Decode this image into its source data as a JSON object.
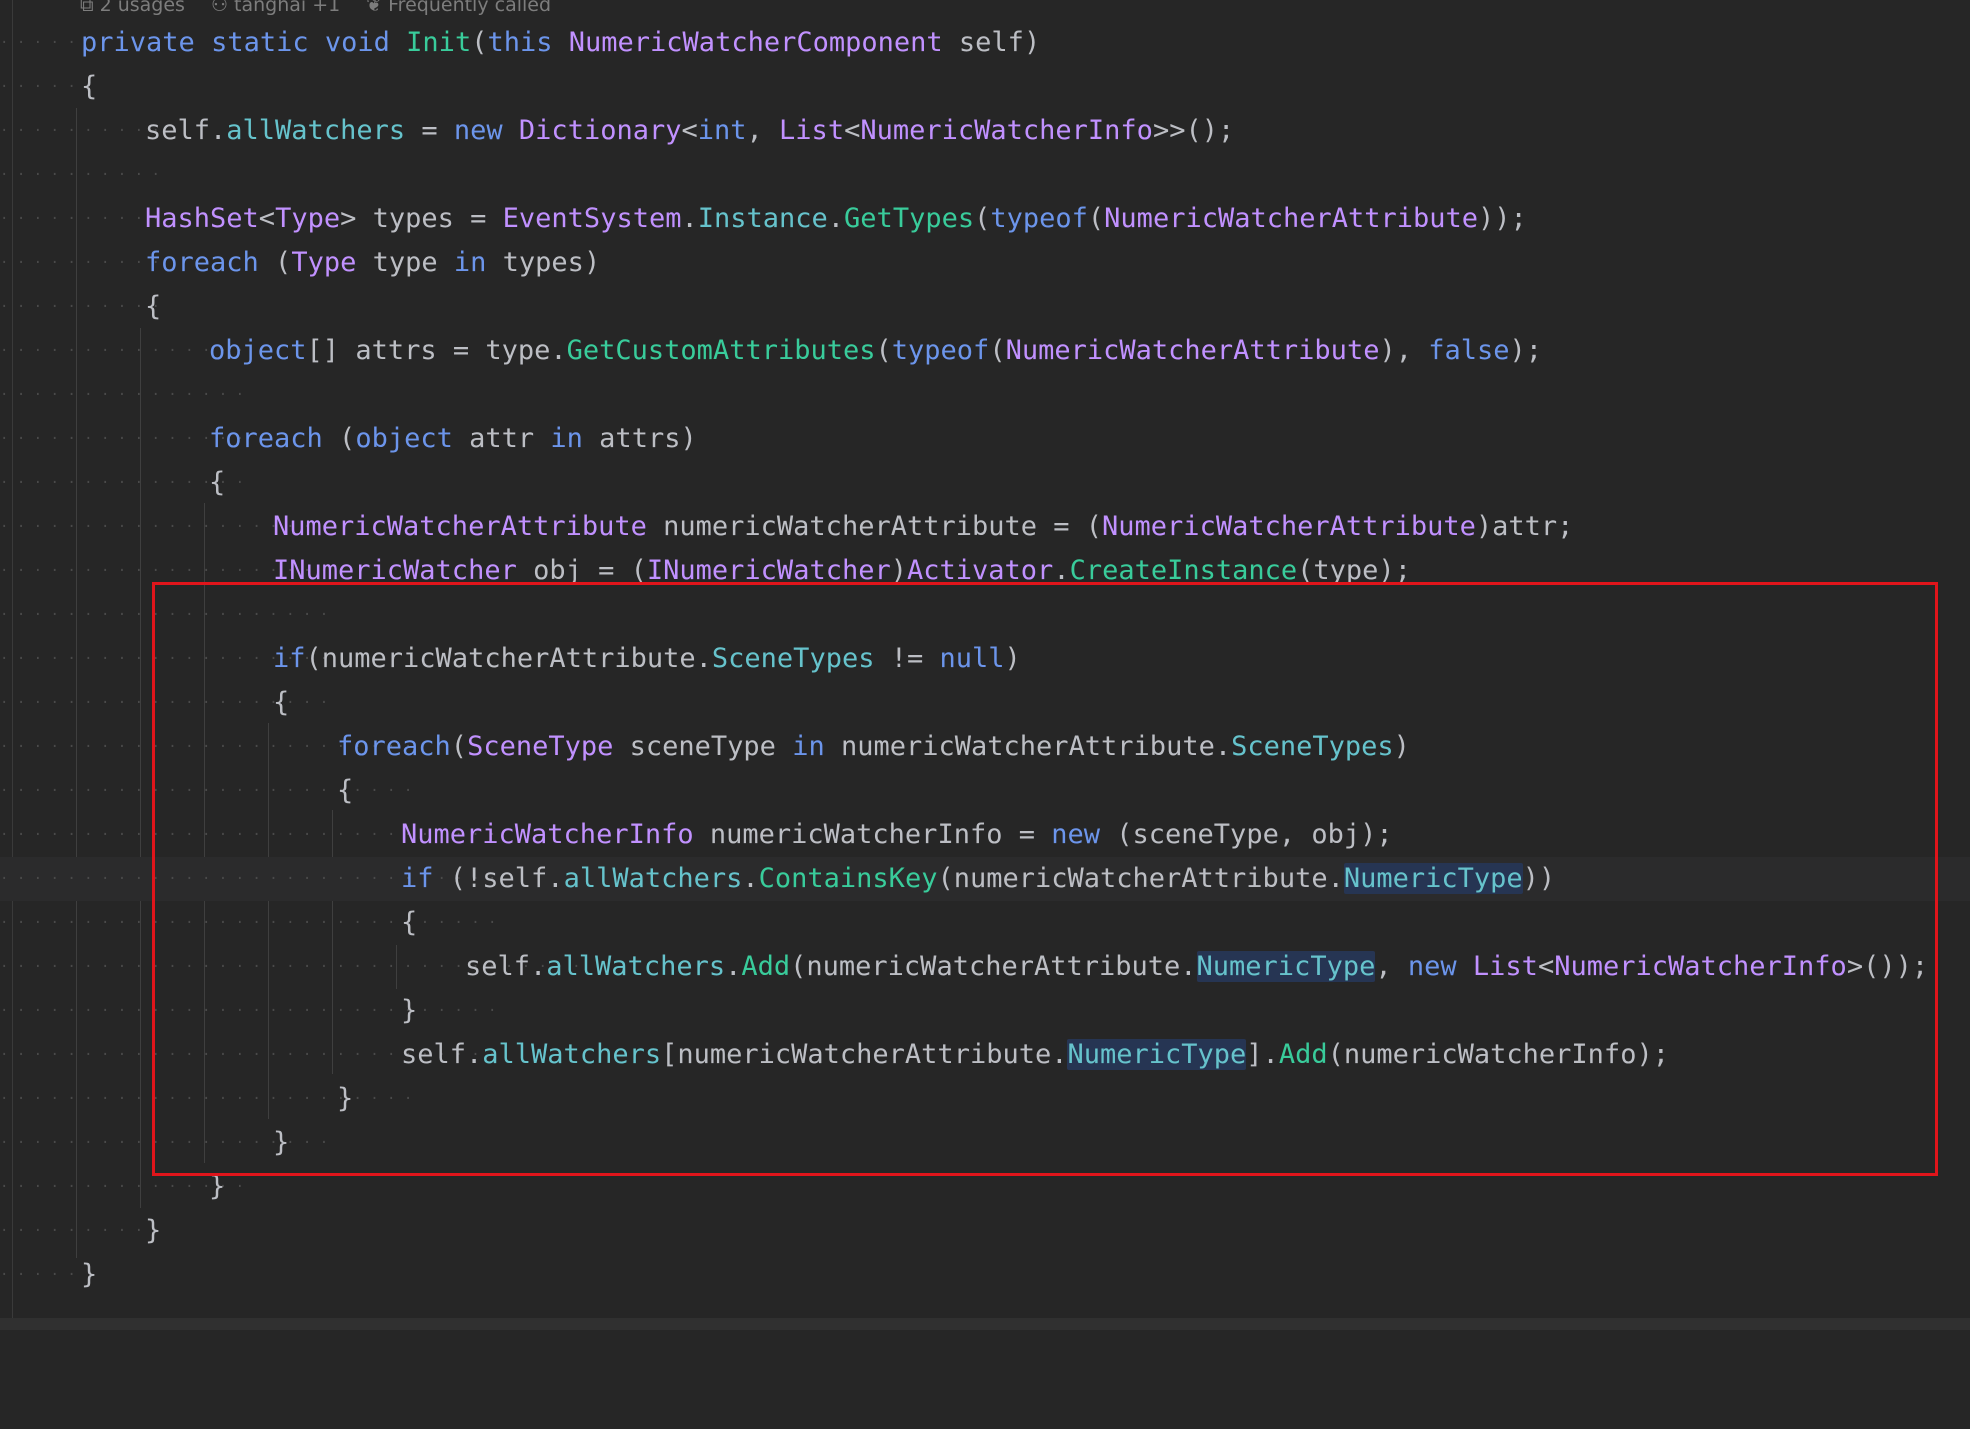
{
  "inlay_hints": {
    "usages": "2 usages",
    "authors": "tanghai +1",
    "frequency": "Frequently called"
  },
  "code": {
    "method_signature": [
      "private",
      "static",
      "void",
      "Init",
      "this",
      "NumericWatcherComponent",
      "self"
    ],
    "line_1": "self.allWatchers = new Dictionary<int, List<NumericWatcherInfo>>();",
    "line_types": "HashSet<Type> types = EventSystem.Instance.GetTypes(typeof(NumericWatcherAttribute));",
    "line_foreach_types": "foreach (Type type in types)",
    "line_attrs": "object[] attrs = type.GetCustomAttributes(typeof(NumericWatcherAttribute), false);",
    "line_foreach_attrs": "foreach (object attr in attrs)",
    "line_cast": "NumericWatcherAttribute numericWatcherAttribute = (NumericWatcherAttribute)attr;",
    "line_obj": "INumericWatcher obj = (INumericWatcher)Activator.CreateInstance(type);",
    "line_if_scene": "if(numericWatcherAttribute.SceneTypes != null)",
    "line_foreach_scene": "foreach(SceneType sceneType in numericWatcherAttribute.SceneTypes)",
    "line_info": "NumericWatcherInfo numericWatcherInfo = new (sceneType, obj);",
    "line_if_contains": "if (!self.allWatchers.ContainsKey(numericWatcherAttribute.NumericType))",
    "line_add_list": "self.allWatchers.Add(numericWatcherAttribute.NumericType, new List<NumericWatcherInfo>());",
    "line_add_info": "self.allWatchers[numericWatcherAttribute.NumericType].Add(numericWatcherInfo);"
  },
  "colors": {
    "background": "#262626",
    "keyword": "#6c95eb",
    "type": "#c191ff",
    "method": "#39cc9b",
    "property": "#66c3cc",
    "plain": "#bcbec4",
    "selection_box": "#e0151b"
  }
}
